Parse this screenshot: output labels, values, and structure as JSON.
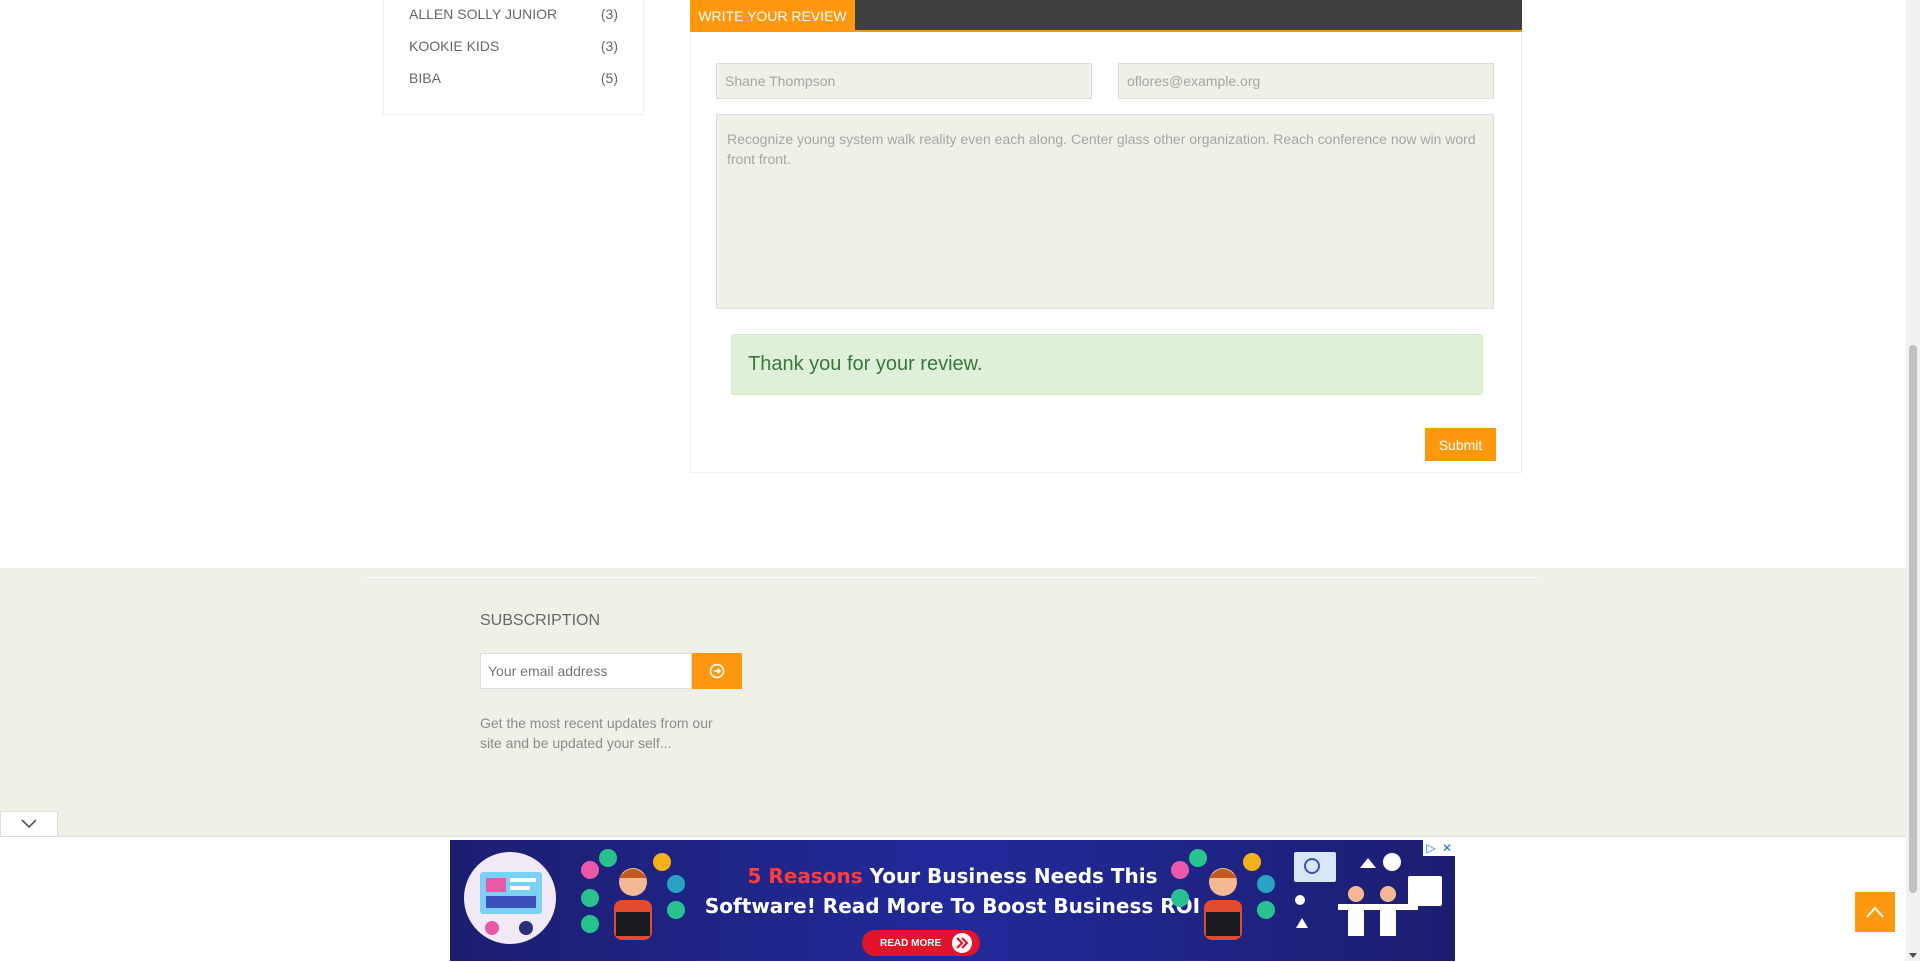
{
  "brands": [
    {
      "name": "ALLEN SOLLY JUNIOR",
      "count": "(3)"
    },
    {
      "name": "KOOKIE KIDS",
      "count": "(3)"
    },
    {
      "name": "BIBA",
      "count": "(5)"
    }
  ],
  "review": {
    "tab_label": "WRITE YOUR REVIEW",
    "name_value": "Shane Thompson",
    "email_value": "oflores@example.org",
    "message_value": "Recognize young system walk reality even each along. Center glass other organization. Reach conference now win word front front.",
    "success_message": "Thank you for your review.",
    "submit_label": "Submit"
  },
  "subscription": {
    "title": "SUBSCRIPTION",
    "email_placeholder": "Your email address",
    "description": "Get the most recent updates from our site and be updated your self..."
  },
  "ad": {
    "headline_highlight": "5 Reasons",
    "headline_rest": " Your Business Needs This",
    "headline_line2": "Software! Read More To Boost Business ROI",
    "cta_label": "READ MORE"
  },
  "colors": {
    "accent": "#fe980f",
    "dark_bar": "#40403e",
    "footer_bg": "#f0f0e9",
    "success_bg": "#dff0d8",
    "success_text": "#3c763d"
  },
  "icons": [
    "arrow-circle-right-icon",
    "chevron-down-icon",
    "chevron-up-icon",
    "adchoices-icon",
    "close-icon"
  ]
}
